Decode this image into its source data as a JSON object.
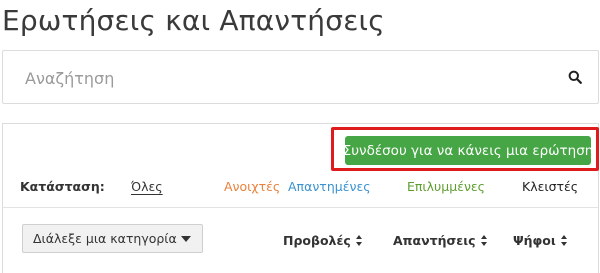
{
  "page": {
    "title": "Ερωτήσεις και Απαντήσεις"
  },
  "search": {
    "placeholder": "Αναζήτηση",
    "value": "",
    "icon": "search-icon"
  },
  "actions": {
    "ask_label": "Συνδέσου για να κάνεις μια ερώτηση",
    "ask_color": "#46a544",
    "highlight_color": "#e01b1b"
  },
  "status_filter": {
    "label": "Κατάσταση:",
    "items": [
      {
        "label": "Όλες",
        "color": "#333333",
        "selected": true
      },
      {
        "label": "Ανοιχτές",
        "color": "#e8823c"
      },
      {
        "label": "Απαντημένες",
        "color": "#3a92d0"
      },
      {
        "label": "Επιλυμμένες",
        "color": "#5e9e2e"
      },
      {
        "label": "Κλειστές",
        "color": "#222222"
      }
    ]
  },
  "category": {
    "selected": "Διάλεξε μια κατηγορία",
    "icon": "chevron-down-icon"
  },
  "sort": {
    "items": [
      {
        "label": "Προβολές",
        "icon": "sort-icon"
      },
      {
        "label": "Απαντήσεις",
        "icon": "sort-icon"
      },
      {
        "label": "Ψήφοι",
        "icon": "sort-icon"
      }
    ]
  }
}
